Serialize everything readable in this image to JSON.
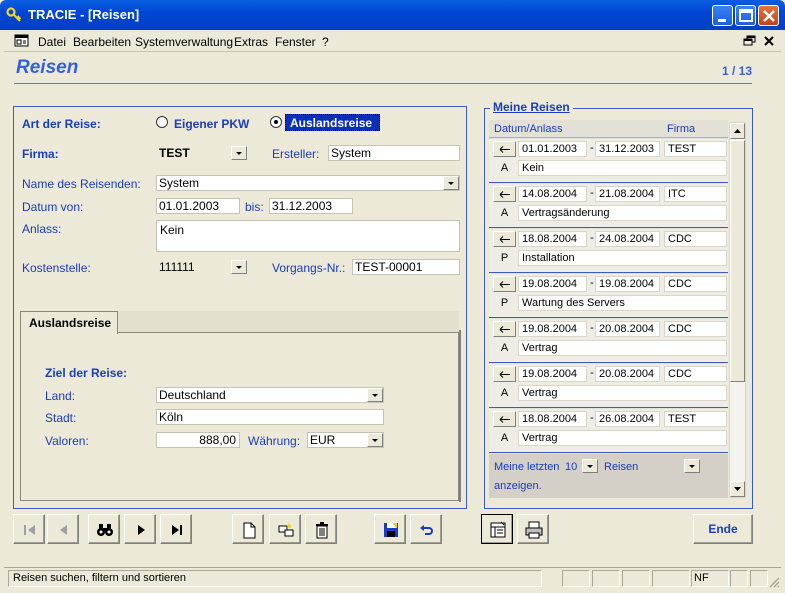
{
  "window": {
    "title": "TRACIE - [Reisen]"
  },
  "menu": {
    "items": [
      "Datei",
      "Bearbeiten",
      "Systemverwaltung",
      "Extras",
      "Fenster",
      "?"
    ]
  },
  "header": {
    "title": "Reisen",
    "page": "1 / 13"
  },
  "form": {
    "art_label": "Art der Reise:",
    "option_pkw": "Eigener PKW",
    "option_ausland": "Auslandsreise",
    "selected": "Auslandsreise",
    "firma_label": "Firma:",
    "firma_value": "TEST",
    "ersteller_label": "Ersteller:",
    "ersteller_value": "System",
    "name_label": "Name des Reisenden:",
    "name_value": "System",
    "datum_label": "Datum von:",
    "datum_von": "01.01.2003",
    "bis_label": "bis:",
    "datum_bis": "31.12.2003",
    "anlass_label": "Anlass:",
    "anlass_value": "Kein",
    "kst_label": "Kostenstelle:",
    "kst_value": "111111",
    "vorgang_label": "Vorgangs-Nr.:",
    "vorgang_value": "TEST-00001"
  },
  "tab": {
    "label": "Auslandsreise",
    "ziel_label": "Ziel der Reise:",
    "land_label": "Land:",
    "land_value": "Deutschland",
    "stadt_label": "Stadt:",
    "stadt_value": "Köln",
    "valoren_label": "Valoren:",
    "valoren_value": "888,00",
    "waehrung_label": "Währung:",
    "waehrung_value": "EUR"
  },
  "meine_reisen": {
    "title": "Meine Reisen",
    "col_datum": "Datum/Anlass",
    "col_firma": "Firma",
    "trips": [
      {
        "von": "01.01.2003",
        "bis": "31.12.2003",
        "firma": "TEST",
        "typ": "A",
        "anlass": "Kein"
      },
      {
        "von": "14.08.2004",
        "bis": "21.08.2004",
        "firma": "ITC",
        "typ": "A",
        "anlass": "Vertragsänderung"
      },
      {
        "von": "18.08.2004",
        "bis": "24.08.2004",
        "firma": "CDC",
        "typ": "P",
        "anlass": "Installation"
      },
      {
        "von": "19.08.2004",
        "bis": "19.08.2004",
        "firma": "CDC",
        "typ": "P",
        "anlass": "Wartung des Servers"
      },
      {
        "von": "19.08.2004",
        "bis": "20.08.2004",
        "firma": "CDC",
        "typ": "A",
        "anlass": "Vertrag"
      },
      {
        "von": "19.08.2004",
        "bis": "20.08.2004",
        "firma": "CDC",
        "typ": "A",
        "anlass": "Vertrag"
      },
      {
        "von": "18.08.2004",
        "bis": "26.08.2004",
        "firma": "TEST",
        "typ": "A",
        "anlass": "Vertrag"
      }
    ],
    "dash": "-",
    "footer_prefix": "Meine letzten",
    "footer_count": "10",
    "footer_suffix": "Reisen",
    "footer_line2": "anzeigen."
  },
  "buttons": {
    "ende": "Ende"
  },
  "status": {
    "text": "Reisen suchen, filtern und sortieren",
    "nf": "NF"
  },
  "colors": {
    "accent": "#3162d6",
    "label": "#1a3dbd",
    "selected_bg": "#0a2fb8"
  }
}
